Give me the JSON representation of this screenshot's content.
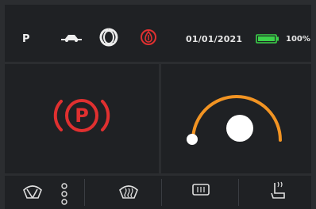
{
  "status_bar": {
    "gear": "P",
    "date": "01/01/2021",
    "battery_percent": "100%",
    "icons": [
      "vehicle-icon",
      "headlight-icon",
      "oil-warning-icon",
      "battery-icon"
    ],
    "colors": {
      "warning": "#e03030",
      "battery": "#3cd24a",
      "text": "#e6e6e6"
    }
  },
  "left_panel": {
    "indicator": "parking-brake-icon",
    "indicator_letter": "P",
    "indicator_color": "#e03030"
  },
  "right_panel": {
    "control": "volume-dial",
    "level_fraction": 0.0,
    "arc_color": "#f29423",
    "knob_color": "#ffffff"
  },
  "bottom_bar": {
    "buttons": [
      "front-wiper-button",
      "wiper-speed-button",
      "front-defrost-button",
      "rear-defrost-button",
      "seat-heater-button"
    ]
  }
}
